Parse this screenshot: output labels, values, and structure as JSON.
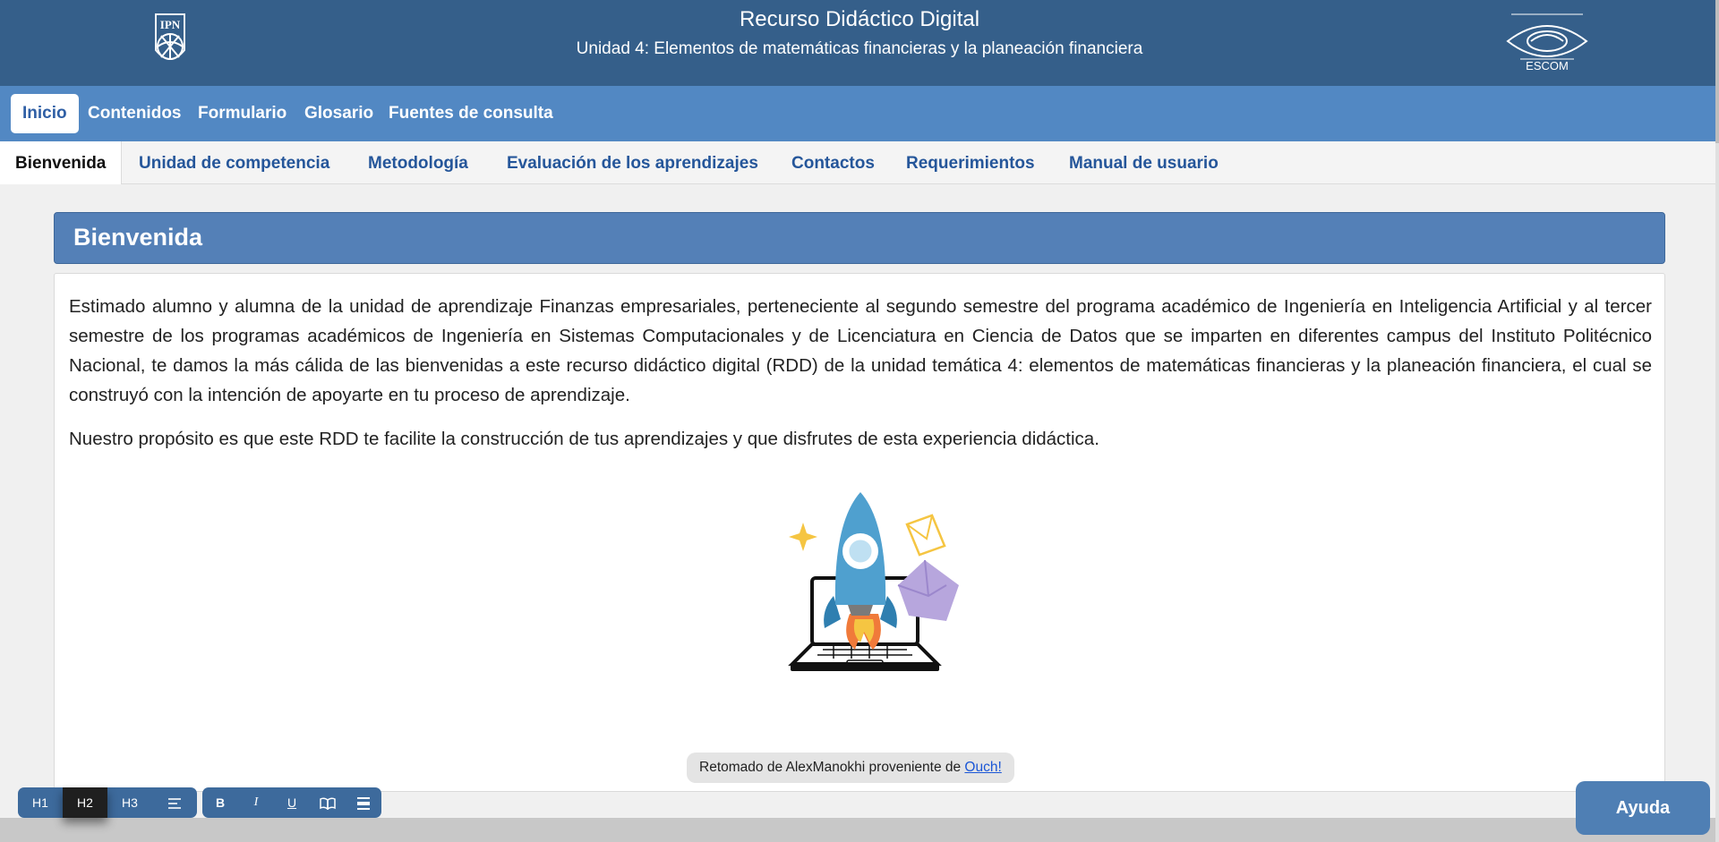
{
  "header": {
    "title": "Recurso Didáctico Digital",
    "subtitle": "Unidad 4: Elementos de matemáticas financieras y la planeación financiera",
    "logo_right_text": "ESCOM",
    "logo_left_text": "IPN",
    "colors": {
      "bar": "#355f8a"
    }
  },
  "main_nav": {
    "items": [
      "Inicio",
      "Contenidos",
      "Formulario",
      "Glosario",
      "Fuentes de consulta"
    ],
    "active": "Inicio"
  },
  "sub_nav": {
    "items": [
      "Bienvenida",
      "Unidad de competencia",
      "Metodología",
      "Evaluación de los aprendizajes",
      "Contactos",
      "Requerimientos",
      "Manual de usuario"
    ],
    "active": "Bienvenida"
  },
  "section": {
    "heading": "Bienvenida",
    "paragraphs": [
      "Estimado alumno y alumna de la unidad de aprendizaje Finanzas empresariales, perteneciente al segundo semestre del programa académico de Ingeniería en Inteligencia Artificial y al tercer semestre de los programas académicos de Ingeniería en Sistemas Computacionales y de Licenciatura en Ciencia de Datos que se imparten en diferentes campus del Instituto Politécnico Nacional, te damos la más cálida de las bienvenidas a este recurso didáctico digital (RDD) de la unidad temática 4: elementos de matemáticas financieras y la planeación financiera, el cual se construyó con la intención de apoyarte en tu proceso de aprendizaje.",
      "Nuestro propósito es que este RDD te facilite la construcción de tus aprendizajes y que disfrutes de esta experiencia didáctica."
    ],
    "illustration_icon": "rocket-laptop-illustration",
    "credit": {
      "text": "Retomado de AlexManokhi proveniente de ",
      "link": "Ouch!"
    }
  },
  "toolbar": {
    "headings": [
      "H1",
      "H2",
      "H3"
    ],
    "active_heading": "H2",
    "icons": [
      "align-left-icon",
      "bold-icon",
      "italic-icon",
      "underline-icon",
      "reading-mode-icon",
      "line-spacing-icon"
    ],
    "bold_label": "B",
    "italic_label": "I",
    "underline_label": "U"
  },
  "help_button": {
    "label": "Ayuda"
  }
}
